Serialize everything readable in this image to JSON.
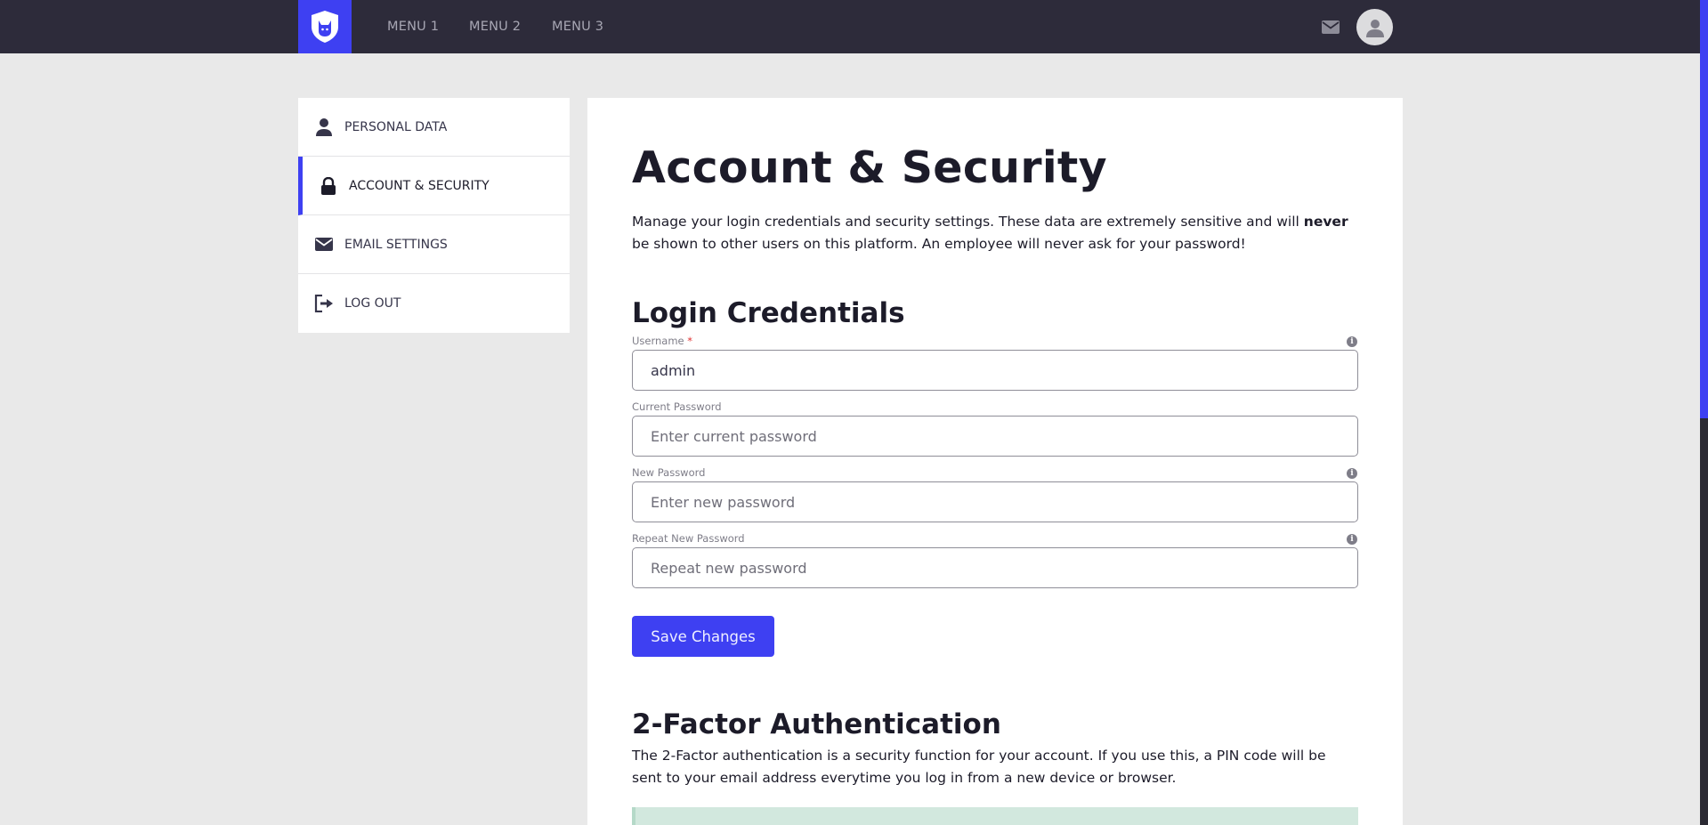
{
  "nav": {
    "menu": [
      "MENU 1",
      "MENU 2",
      "MENU 3"
    ],
    "logo_icon": "shield-cat-icon",
    "mail_icon": "envelope-icon",
    "avatar_icon": "user-avatar-icon"
  },
  "sidebar": {
    "items": [
      {
        "label": "PERSONAL DATA",
        "icon": "user-icon",
        "active": false
      },
      {
        "label": "ACCOUNT & SECURITY",
        "icon": "lock-icon",
        "active": true
      },
      {
        "label": "EMAIL SETTINGS",
        "icon": "envelope-icon",
        "active": false
      },
      {
        "label": "LOG OUT",
        "icon": "logout-icon",
        "active": false
      }
    ]
  },
  "main": {
    "title": "Account & Security",
    "intro_before": "Manage your login credentials and security settings. These data are extremely sensitive and will ",
    "intro_bold": "never",
    "intro_after": " be shown to other users on this platform. An employee will never ask for your password!",
    "login_heading": "Login Credentials",
    "fields": {
      "username": {
        "label": "Username",
        "required_mark": "*",
        "value": "admin",
        "placeholder": ""
      },
      "current_password": {
        "label": "Current Password",
        "value": "",
        "placeholder": "Enter current password"
      },
      "new_password": {
        "label": "New Password",
        "value": "",
        "placeholder": "Enter new password"
      },
      "repeat_password": {
        "label": "Repeat New Password",
        "value": "",
        "placeholder": "Repeat new password"
      }
    },
    "save_label": "Save Changes",
    "tfa_heading": "2-Factor Authentication",
    "tfa_text": "The 2-Factor authentication is a security function for your account. If you use this, a PIN code will be sent to your email address everytime you log in from a new device or browser."
  },
  "colors": {
    "accent": "#3e40f2",
    "topbar": "#2d2b3a",
    "background": "#e9e9e9",
    "alert": "#d2e8de"
  }
}
